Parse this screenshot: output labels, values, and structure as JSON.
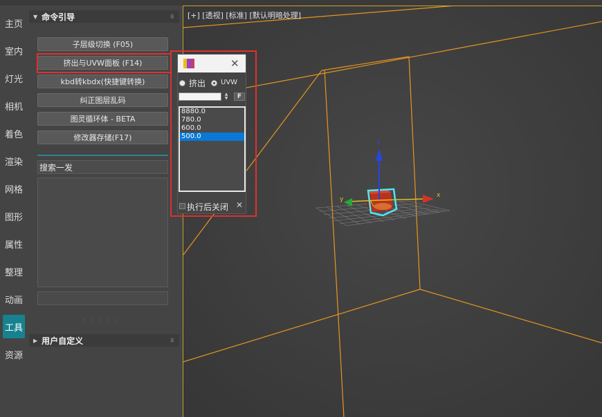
{
  "rail": {
    "items": [
      {
        "label": "主页",
        "active": false
      },
      {
        "label": "室内",
        "active": false
      },
      {
        "label": "灯光",
        "active": false
      },
      {
        "label": "相机",
        "active": false
      },
      {
        "label": "着色",
        "active": false
      },
      {
        "label": "渲染",
        "active": false
      },
      {
        "label": "网格",
        "active": false
      },
      {
        "label": "图形",
        "active": false
      },
      {
        "label": "属性",
        "active": false
      },
      {
        "label": "整理",
        "active": false
      },
      {
        "label": "动画",
        "active": false
      },
      {
        "label": "工具",
        "active": true
      },
      {
        "label": "资源",
        "active": false
      }
    ]
  },
  "panel": {
    "rollout_title": "命令引导",
    "rollout2_title": "用户自定义",
    "buttons": [
      "子层级切换 (F05)",
      "挤出与UVW面板 (F14)",
      "kbd转kbdx(快捷键转换)",
      "纠正图层乱码",
      "图灵循环体 - BETA",
      "修改器存储(F17)"
    ],
    "search_value": "搜索一发",
    "grip_dots": ": : : : :"
  },
  "viewport": {
    "label": "[+] [透视] [标准] [默认明暗处理]",
    "axis_x": "x",
    "axis_y": "y",
    "axis_z": "z"
  },
  "dialog": {
    "radio_extrude": "挤出",
    "radio_uvw": "UVW",
    "selected_radio": "uvw",
    "f_button": "F",
    "values": [
      "8880.0",
      "780.0",
      "600.0",
      "500.0"
    ],
    "selected_index": 3,
    "checkbox_label": "执行后关闭",
    "close_glyph": "✕"
  },
  "colors": {
    "accent": "#17828f",
    "highlight_frame": "#e03030",
    "viewport_border": "#c9a227",
    "list_selection": "#0a78d6",
    "wire": "#e8961e"
  }
}
